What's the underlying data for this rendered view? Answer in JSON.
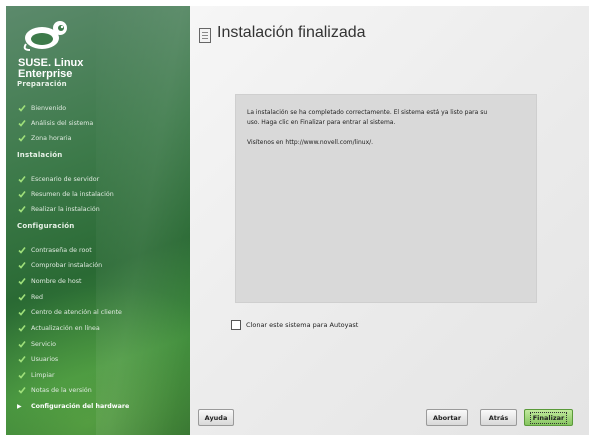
{
  "brand": {
    "line1": "SUSE. Linux",
    "line2": "Enterprise"
  },
  "sidebar": {
    "sections": [
      {
        "title": "Preparación",
        "items": [
          "Bienvenido",
          "Análisis del sistema",
          "Zona horaria"
        ]
      },
      {
        "title": "Instalación",
        "items": [
          "Escenario de servidor",
          "Resumen de la instalación",
          "Realizar la instalación"
        ]
      },
      {
        "title": "Configuración",
        "items": [
          "Contraseña de root",
          "Comprobar instalación",
          "Nombre de host",
          "Red",
          "Centro de atención al cliente",
          "Actualización en línea",
          "Servicio",
          "Usuarios",
          "Limpiar",
          "Notas de la versión"
        ]
      }
    ],
    "current_item": "Configuración del hardware"
  },
  "main": {
    "title": "Instalación finalizada",
    "message_line1": "La instalación se ha completado correctamente. El sistema está ya listo para su",
    "message_line2": "uso. Haga clic en Finalizar para entrar al sistema.",
    "message_line3": "Visítenos en http://www.novell.com/linux/.",
    "checkbox_label": "Clonar este sistema para Autoyast",
    "checkbox_checked": false
  },
  "buttons": {
    "help": "Ayuda",
    "abort": "Abortar",
    "back": "Atrás",
    "finish": "Finalizar"
  },
  "colors": {
    "sidebar_green": "#2a6a34",
    "finish_green": "#86c560"
  }
}
